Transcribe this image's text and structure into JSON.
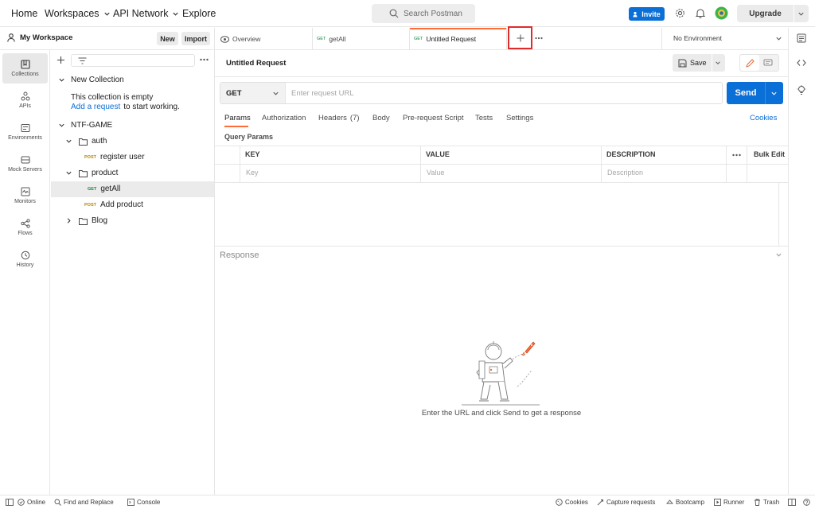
{
  "topnav": {
    "home": "Home",
    "workspaces": "Workspaces",
    "api_network": "API Network",
    "explore": "Explore",
    "search_placeholder": "Search Postman",
    "invite": "Invite",
    "upgrade": "Upgrade"
  },
  "workspace": {
    "name": "My Workspace",
    "new_label": "New",
    "import_label": "Import"
  },
  "sidebar_nav": [
    {
      "label": "Collections",
      "icon": "collections-icon"
    },
    {
      "label": "APIs",
      "icon": "apis-icon"
    },
    {
      "label": "Environments",
      "icon": "environments-icon"
    },
    {
      "label": "Mock Servers",
      "icon": "mock-servers-icon"
    },
    {
      "label": "Monitors",
      "icon": "monitors-icon"
    },
    {
      "label": "Flows",
      "icon": "flows-icon"
    },
    {
      "label": "History",
      "icon": "history-icon"
    }
  ],
  "collections": {
    "new_collection": "New Collection",
    "empty_text": "This collection is empty",
    "add_request": "Add a request",
    "empty_suffix": "to start working.",
    "ntf": "NTF-GAME",
    "auth": "auth",
    "register_method": "POST",
    "register": "register user",
    "product": "product",
    "getall_method": "GET",
    "getall": "getAll",
    "addproduct_method": "POST",
    "addproduct": "Add product",
    "blog": "Blog"
  },
  "tabs": {
    "overview": "Overview",
    "getall_method": "GET",
    "getall": "getAll",
    "untitled_method": "GET",
    "untitled": "Untitled Request",
    "environment": "No Environment"
  },
  "request": {
    "title": "Untitled Request",
    "save": "Save",
    "method": "GET",
    "url_placeholder": "Enter request URL",
    "send": "Send"
  },
  "subtabs": {
    "params": "Params",
    "authorization": "Authorization",
    "headers": "Headers",
    "headers_count": "(7)",
    "body": "Body",
    "prerequest": "Pre-request Script",
    "tests": "Tests",
    "settings": "Settings",
    "cookies": "Cookies"
  },
  "params": {
    "section": "Query Params",
    "col_key": "KEY",
    "col_value": "VALUE",
    "col_description": "DESCRIPTION",
    "bulk_edit": "Bulk Edit",
    "key_ph": "Key",
    "value_ph": "Value",
    "description_ph": "Description"
  },
  "response": {
    "label": "Response",
    "empty_msg": "Enter the URL and click Send to get a response"
  },
  "footer": {
    "online": "Online",
    "find_replace": "Find and Replace",
    "console": "Console",
    "cookies": "Cookies",
    "capture": "Capture requests",
    "bootcamp": "Bootcamp",
    "runner": "Runner",
    "trash": "Trash"
  },
  "colors": {
    "accent_orange": "#ff6c37",
    "send_blue": "#0a6fd6",
    "highlight_red": "#e02b2b"
  }
}
